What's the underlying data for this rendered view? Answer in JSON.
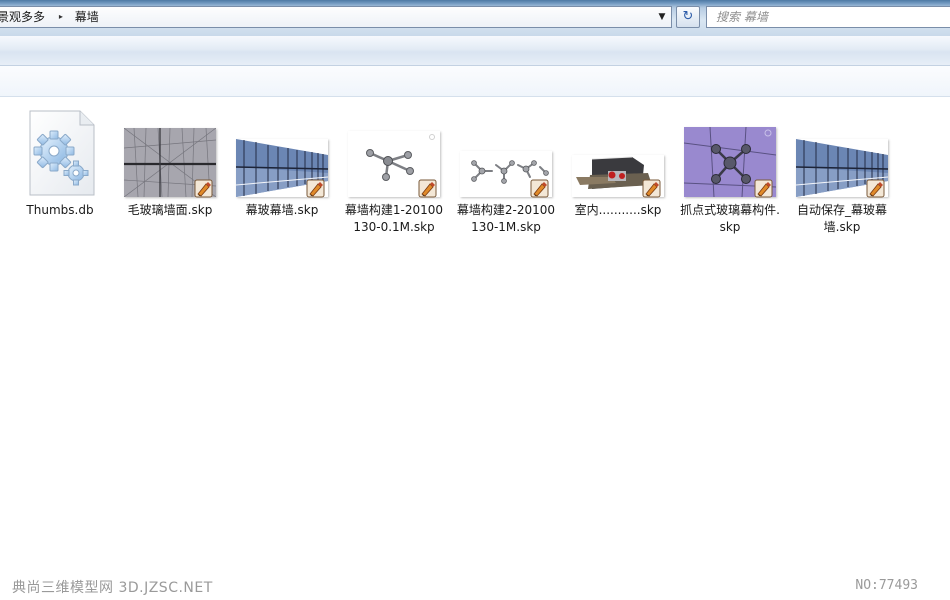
{
  "address_bar": {
    "crumbs": [
      "景观多多",
      "幕墙"
    ],
    "separator": "▸",
    "dropdown_glyph": "▼"
  },
  "refresh_button": {
    "glyph": "↻",
    "icon": "refresh-icon"
  },
  "search": {
    "placeholder": "搜索 幕墙"
  },
  "files": [
    {
      "name": "Thumbs.db",
      "icon": "gear-file-icon"
    },
    {
      "name": "毛玻璃墙面.skp",
      "icon": "sketchup-badge-icon"
    },
    {
      "name": "幕玻幕墙.skp",
      "icon": "sketchup-badge-icon"
    },
    {
      "name": "幕墙构建1-20100130-0.1M.skp",
      "icon": "sketchup-badge-icon"
    },
    {
      "name": "幕墙构建2-20100130-1M.skp",
      "icon": "sketchup-badge-icon"
    },
    {
      "name": "室内...........skp",
      "icon": "sketchup-badge-icon"
    },
    {
      "name": "抓点式玻璃幕构件.skp",
      "icon": "sketchup-badge-icon"
    },
    {
      "name": "自动保存_幕玻幕墙.skp",
      "icon": "sketchup-badge-icon"
    }
  ],
  "watermark": {
    "left": "典尚三维模型网 3D.JZSC.NET",
    "right": "NO:77493"
  },
  "colors": {
    "chrome_blue": "#b7cde3",
    "selection_purple": "#8e7fc8",
    "badge_orange": "#e08a2a"
  }
}
